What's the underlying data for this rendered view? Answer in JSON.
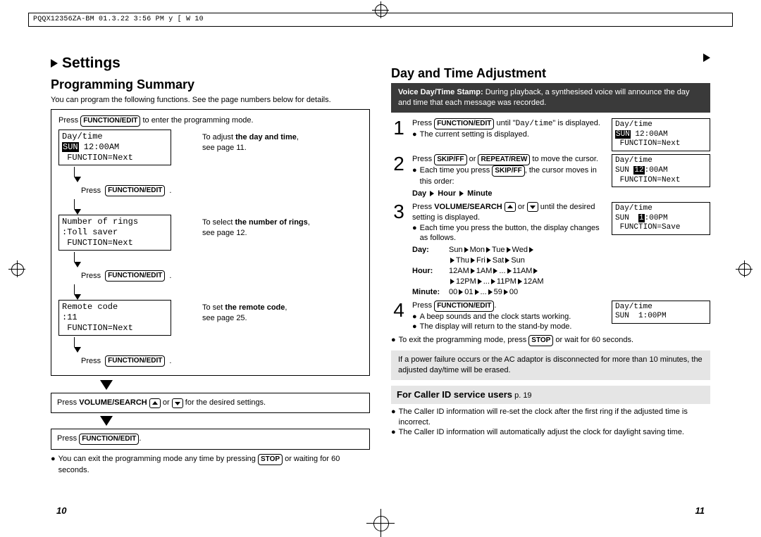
{
  "header": {
    "docid": "PQQX12356ZA-BM 01.3.22 3:56 PM  y [ W  10"
  },
  "left": {
    "section_title": "Settings",
    "heading": "Programming Summary",
    "intro": "You can program the following functions. See the page numbers below for details.",
    "flow_intro_a": "Press ",
    "key_function_edit": "FUNCTION/EDIT",
    "flow_intro_b": " to enter the programming mode.",
    "lcd1_l1": "Day/time",
    "lcd1_l2a": "SUN",
    "lcd1_l2b": " 12:00AM",
    "lcd1_l3": " FUNCTION=Next",
    "flow1_desc_a": "To adjust ",
    "flow1_desc_b": "the day and time",
    "flow1_desc_c": ",",
    "flow1_desc_d": "see page 11.",
    "press_label": "Press ",
    "lcd2_l1": "Number of rings",
    "lcd2_l2": ":Toll saver",
    "lcd2_l3": " FUNCTION=Next",
    "flow2_desc_a": "To select ",
    "flow2_desc_b": "the number of rings",
    "flow2_desc_c": ",",
    "flow2_desc_d": "see page 12.",
    "lcd3_l1": "Remote code",
    "lcd3_l2": ":11",
    "lcd3_l3": " FUNCTION=Next",
    "flow3_desc_a": "To set ",
    "flow3_desc_b": "the remote code",
    "flow3_desc_c": ",",
    "flow3_desc_d": "see page 25.",
    "vol_line_a": "Press ",
    "vol_line_b": "VOLUME/SEARCH",
    "vol_line_c": " or ",
    "vol_line_d": " for the desired settings.",
    "exit_note": "You can exit the programming mode any time by pressing ",
    "key_stop": "STOP",
    "exit_note_b": " or waiting for 60 seconds.",
    "page_num": "10"
  },
  "right": {
    "heading": "Day and Time Adjustment",
    "voice_a": "Voice Day/Time Stamp:",
    "voice_b": " During playback, a synthesised voice will announce the day and time that each message was recorded.",
    "step1_a": "Press ",
    "step1_b": " until \"",
    "step1_c": "Day/time",
    "step1_d": "\" is displayed.",
    "step1_note": "The current setting is displayed.",
    "lcd_s1_l1": "Day/time",
    "lcd_s1_l2a": "SUN",
    "lcd_s1_l2b": " 12:00AM",
    "lcd_s1_l3": " FUNCTION=Next",
    "step2_a": "Press ",
    "key_skipff": "SKIP/FF",
    "step2_b": " or ",
    "key_repeatrew": "REPEAT/REW",
    "step2_c": " to move the cursor.",
    "step2_note_a": "Each time you press ",
    "step2_note_b": ", the cursor moves in this order:",
    "step2_order_a": "Day ",
    "step2_order_b": " Hour ",
    "step2_order_c": " Minute",
    "lcd_s2_l1": "Day/time",
    "lcd_s2_l2a": "SUN ",
    "lcd_s2_l2b": "12",
    "lcd_s2_l2c": ":00AM",
    "lcd_s2_l3": " FUNCTION=Next",
    "step3_a": "Press ",
    "step3_b": "VOLUME/SEARCH",
    "step3_c": " or ",
    "step3_d": " until the desired setting is displayed.",
    "step3_note": "Each time you press the button, the display changes as follows.",
    "day_label": "Day:",
    "day_seq": "Sun  Mon  Tue  Wed  Thu  Fri  Sat  Sun",
    "hour_label": "Hour:",
    "hour_seq": "12AM  1AM  ...  11AM  12PM  ...  11PM  12AM",
    "minute_label": "Minute:",
    "minute_seq": "00  01  ...  59  00",
    "lcd_s3_l1": "Day/time",
    "lcd_s3_l2a": "SUN  ",
    "lcd_s3_l2b": "1",
    "lcd_s3_l2c": ":00PM",
    "lcd_s3_l3": " FUNCTION=Save",
    "step4_a": "Press ",
    "step4_note1": "A beep sounds and the clock starts working.",
    "step4_note2": "The display will return to the stand-by mode.",
    "lcd_s4_l1": "Day/time",
    "lcd_s4_l2": "SUN  1:00PM",
    "exit_hint_a": "To exit the programming mode, press ",
    "exit_hint_b": " or wait for 60 seconds.",
    "power_note": "If a power failure occurs or the AC adaptor is disconnected for more than 10 minutes, the adjusted day/time will be erased.",
    "cid_title": "For Caller ID service users",
    "cid_ref": " p. 19",
    "cid_b1": "The Caller ID information will re-set the clock after the first ring if the adjusted time is incorrect.",
    "cid_b2": "The Caller ID information will automatically adjust the clock for daylight saving time.",
    "page_num": "11"
  }
}
